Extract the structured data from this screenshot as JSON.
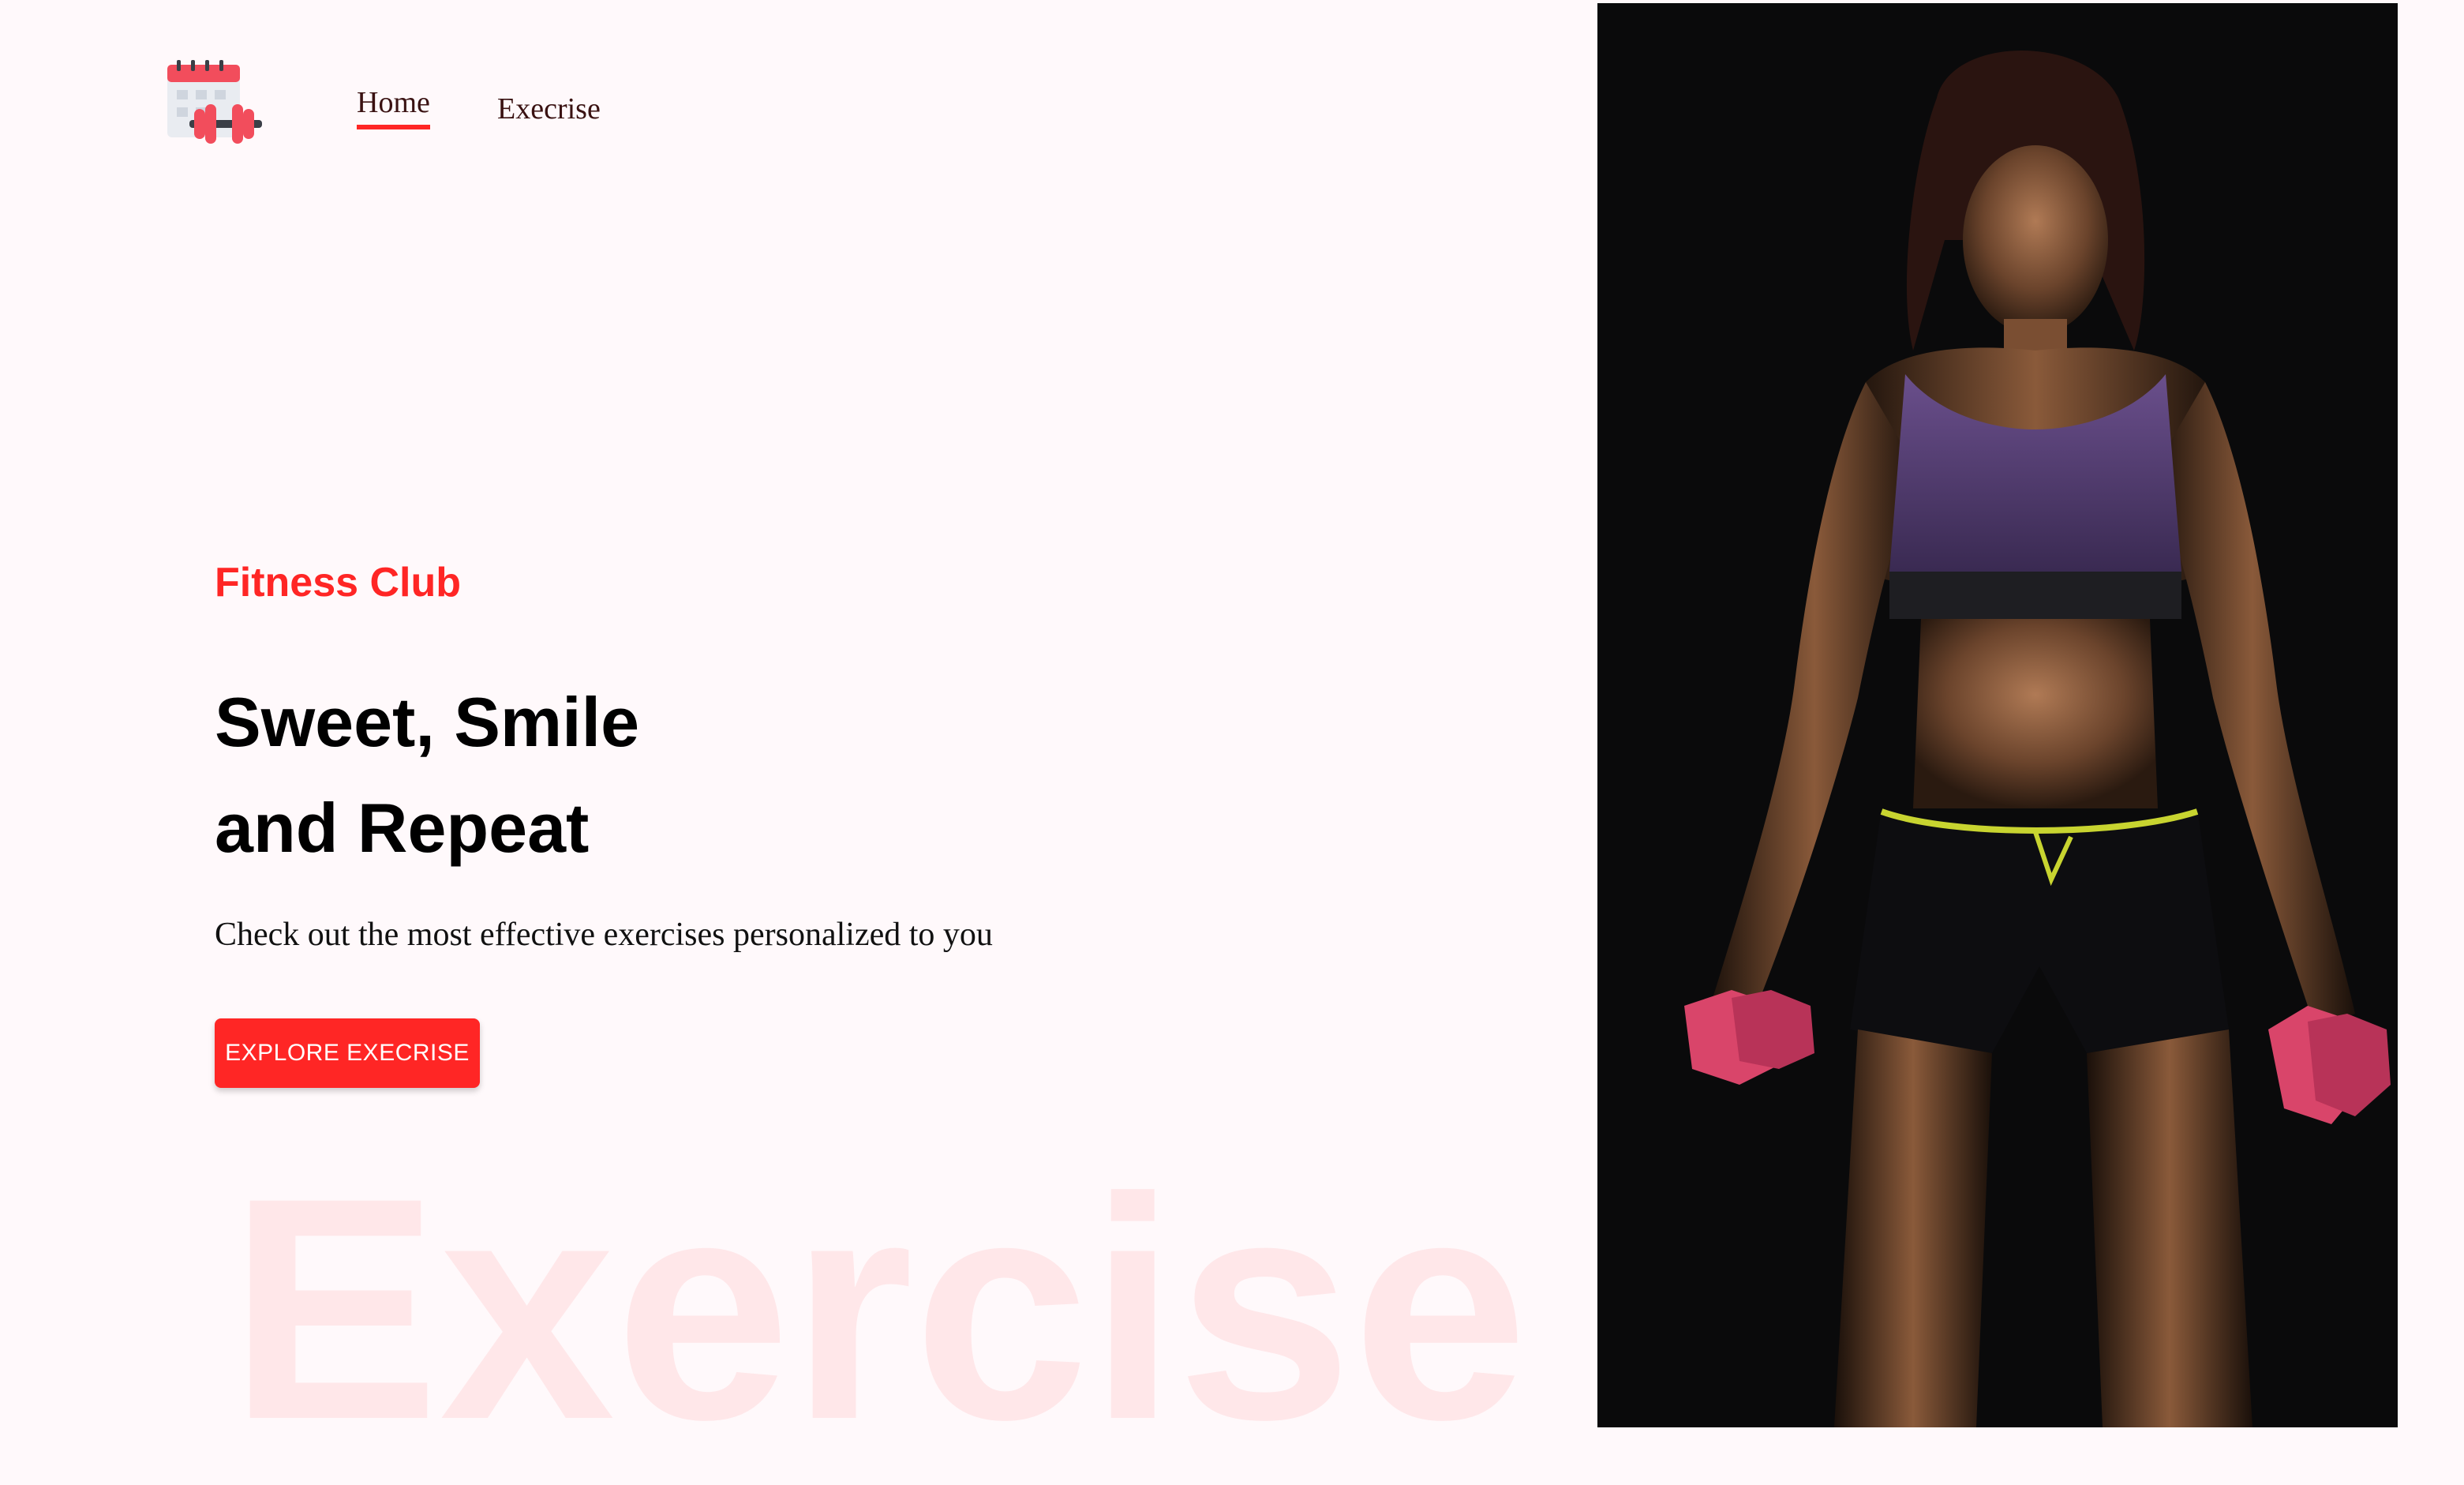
{
  "colors": {
    "accent": "#ff2625",
    "page_background": "#fff9fb",
    "hero_background": "#0a0a0b"
  },
  "logo": {
    "icon": "calendar-dumbbell-icon"
  },
  "nav": {
    "items": [
      {
        "label": "Home",
        "active": true
      },
      {
        "label": "Execrise",
        "active": false
      }
    ]
  },
  "hero": {
    "eyebrow": "Fitness Club",
    "headline_line1": "Sweet, Smile",
    "headline_line2": "and Repeat",
    "subtitle": "Check out the most effective exercises personalized to you",
    "cta_label": "EXPLORE EXECRISE",
    "watermark": "Exercise"
  },
  "banner_image": {
    "subject": "woman holding pink dumbbells"
  }
}
